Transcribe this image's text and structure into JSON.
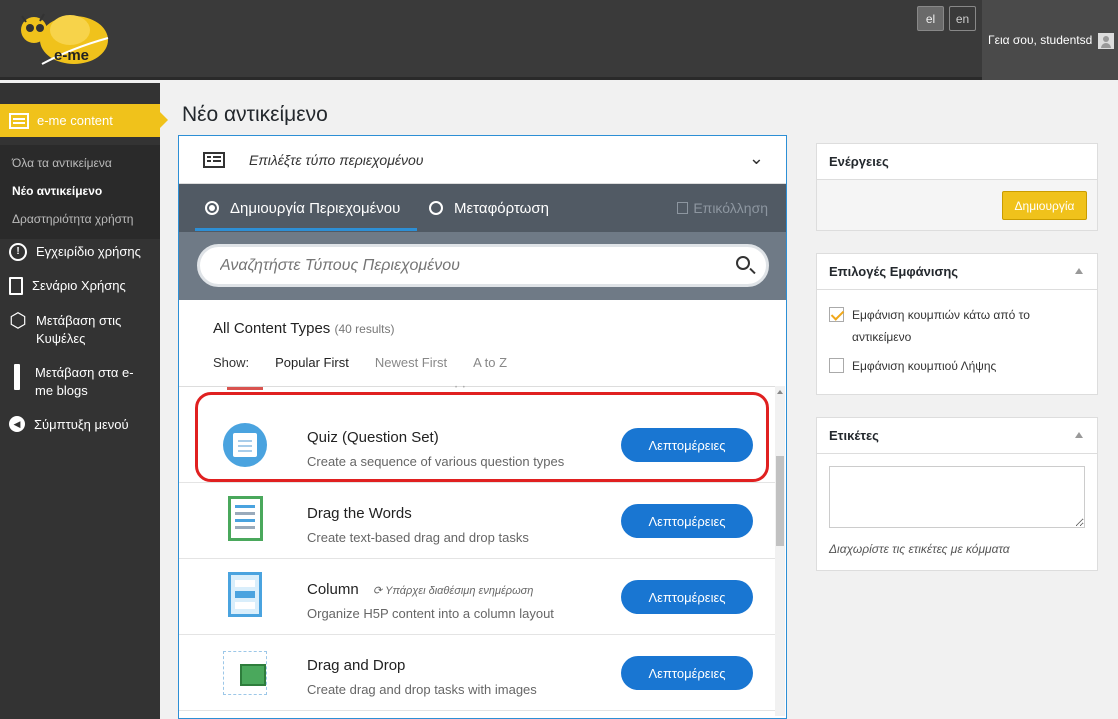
{
  "header": {
    "logo_text": "e-me",
    "lang_el": "el",
    "lang_en": "en",
    "greeting": "Γεια σου, studentsd"
  },
  "sidebar": {
    "active_label": "e-me content",
    "sub_items": [
      "Όλα τα αντικείμενα",
      "Νέο αντικείμενο",
      "Δραστηριότητα χρήστη"
    ],
    "manual": "Εγχειρίδιο χρήσης",
    "scenario": "Σενάριο Χρήσης",
    "hives": "Μετάβαση στις Κυψέλες",
    "blogs": "Μετάβαση στα e-me blogs",
    "collapse": "Σύμπτυξη μενού"
  },
  "page": {
    "title": "Νέο αντικείμενο"
  },
  "editor": {
    "type_select_label": "Επιλέξτε τύπο περιεχομένου",
    "tab_create": "Δημιουργία Περιεχομένου",
    "tab_upload": "Μεταφόρτωση",
    "paste": "Επικόλληση",
    "search_placeholder": "Αναζητήστε Τύπους Περιεχομένου",
    "list_title": "All Content Types",
    "list_count": "(40 results)",
    "show_label": "Show:",
    "sort_options": [
      "Popular First",
      "Newest First",
      "A to Z"
    ],
    "details_label": "Λεπτομέρειες",
    "items": [
      {
        "title": "Quiz (Question Set)",
        "desc": "Create a sequence of various question types",
        "update": ""
      },
      {
        "title": "Drag the Words",
        "desc": "Create text-based drag and drop tasks",
        "update": ""
      },
      {
        "title": "Column",
        "desc": "Organize H5P content into a column layout",
        "update": "Υπάρχει διαθέσιμη ενημέρωση"
      },
      {
        "title": "Drag and Drop",
        "desc": "Create drag and drop tasks with images",
        "update": ""
      }
    ]
  },
  "right": {
    "actions_title": "Ενέργειες",
    "create_label": "Δημιουργία",
    "display_title": "Επιλογές Εμφάνισης",
    "opt1": "Εμφάνιση κουμπιών κάτω από το αντικείμενο",
    "opt2": "Εμφάνιση κουμπιού Λήψης",
    "tags_title": "Ετικέτες",
    "tags_hint": "Διαχωρίστε τις ετικέτες με κόμματα"
  },
  "colors": {
    "accent": "#f0c21b",
    "button_blue": "#1976d2",
    "highlight_red": "#e02020"
  }
}
